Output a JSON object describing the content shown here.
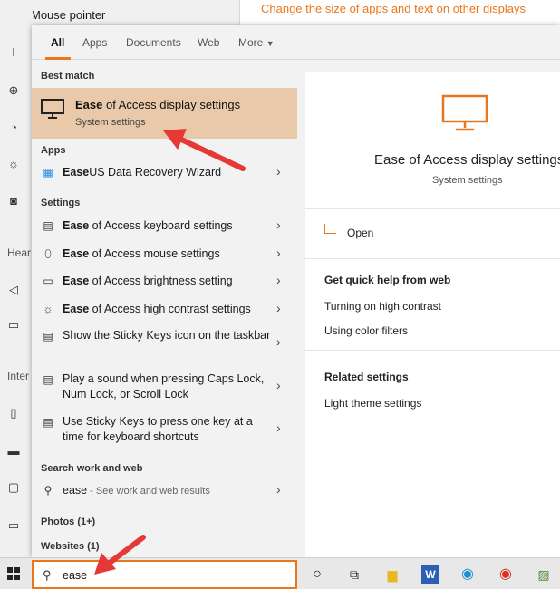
{
  "background": {
    "top_item_label": "Mouse pointer",
    "top_link": "Change the size of apps and text on other displays",
    "headings": [
      "Hear",
      "Inter"
    ]
  },
  "tabs": {
    "all": "All",
    "apps": "Apps",
    "documents": "Documents",
    "web": "Web",
    "more": "More"
  },
  "results": {
    "best_match_header": "Best match",
    "best_match_title_bold": "Ease",
    "best_match_title_rest": " of Access display settings",
    "best_match_subtitle": "System settings",
    "apps_header": "Apps",
    "apps": [
      {
        "bold": "Ease",
        "rest": "US Data Recovery Wizard"
      }
    ],
    "settings_header": "Settings",
    "settings": [
      {
        "bold": "Ease",
        "rest": " of Access keyboard settings"
      },
      {
        "bold": "Ease",
        "rest": " of Access mouse settings"
      },
      {
        "bold": "Ease",
        "rest": " of Access brightness setting"
      },
      {
        "bold": "Ease",
        "rest": " of Access high contrast settings"
      },
      {
        "bold": "",
        "rest": "Show the Sticky Keys icon on the taskbar"
      },
      {
        "bold": "",
        "rest": "Play a sound when pressing Caps Lock, Num Lock, or Scroll Lock"
      },
      {
        "bold": "",
        "rest": "Use Sticky Keys to press one key at a time for keyboard shortcuts"
      }
    ],
    "search_web_header": "Search work and web",
    "search_web_query": "ease",
    "search_web_hint": " - See work and web results",
    "photos_header": "Photos (1+)",
    "websites_header": "Websites (1)"
  },
  "detail": {
    "title": "Ease of Access display settings",
    "subtitle": "System settings",
    "open": "Open",
    "quick_help_header": "Get quick help from web",
    "quick_help_links": [
      "Turning on high contrast",
      "Using color filters"
    ],
    "related_header": "Related settings",
    "related_links": [
      "Light theme settings"
    ]
  },
  "taskbar": {
    "search_value": "ease"
  },
  "colors": {
    "accent": "#e8771e",
    "highlight": "#e9c9a9",
    "arrow": "#e53935"
  }
}
